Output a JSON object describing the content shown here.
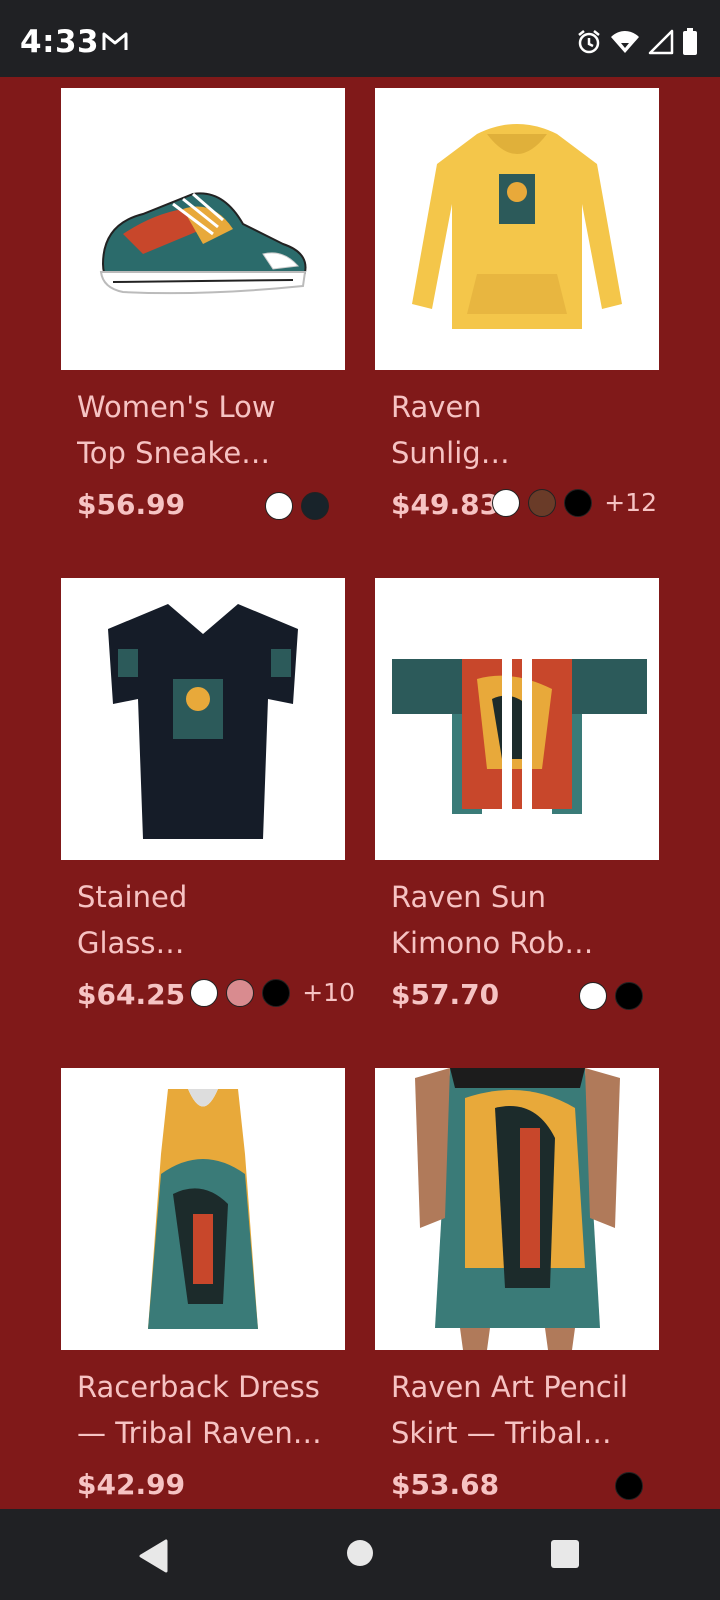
{
  "status": {
    "time": "4:33"
  },
  "products": [
    {
      "title_lines": [
        "Women's Low",
        "Top Sneake…"
      ],
      "price": "$56.99",
      "swatches": [
        "#ffffff",
        "#18232a"
      ],
      "more": ""
    },
    {
      "title_lines": [
        "Raven",
        "Sunlig…"
      ],
      "price": "$49.83",
      "swatches": [
        "#ffffff",
        "#6a3b28",
        "#000000"
      ],
      "more": "+12"
    },
    {
      "title_lines": [
        "Stained",
        "Glass…"
      ],
      "price": "$64.25",
      "swatches": [
        "#ffffff",
        "#d98b8f",
        "#000000"
      ],
      "more": "+10"
    },
    {
      "title_lines": [
        "Raven Sun",
        "Kimono Rob…"
      ],
      "price": "$57.70",
      "swatches": [
        "#ffffff",
        "#000000"
      ],
      "more": ""
    },
    {
      "title_lines": [
        "Racerback Dress",
        "— Tribal Raven…"
      ],
      "price": "$42.99",
      "swatches": [],
      "more": ""
    },
    {
      "title_lines": [
        "Raven Art Pencil",
        "Skirt — Tribal…"
      ],
      "price": "$53.68",
      "swatches": [
        "#000000"
      ],
      "more": ""
    }
  ],
  "colors": {
    "background": "#801919",
    "text": "#f6c3c3",
    "bars": "#202124"
  }
}
